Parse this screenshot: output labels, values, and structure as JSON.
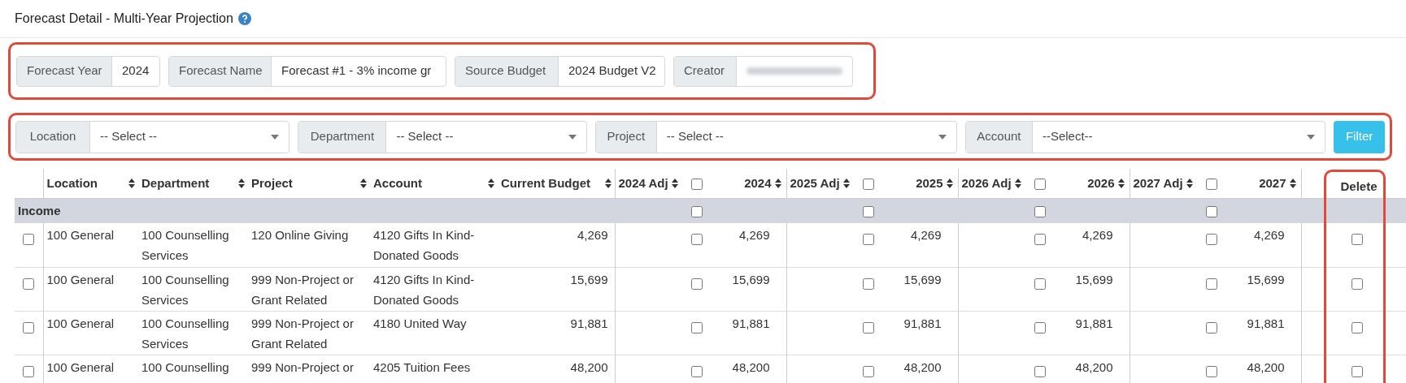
{
  "page_title": "Forecast Detail - Multi-Year Projection",
  "info_fields": [
    {
      "label": "Forecast Year",
      "value": "2024"
    },
    {
      "label": "Forecast Name",
      "value": "Forecast #1 - 3% income gr"
    },
    {
      "label": "Source Budget",
      "value": "2024 Budget V2"
    },
    {
      "label": "Creator",
      "kind": "blurred"
    }
  ],
  "filters": [
    {
      "label": "Location",
      "value": "-- Select --"
    },
    {
      "label": "Department",
      "value": "-- Select --"
    },
    {
      "label": "Project",
      "value": "-- Select --"
    },
    {
      "label": "Account",
      "value": "--Select--"
    }
  ],
  "filter_button": "Filter",
  "table": {
    "columns": [
      "Location",
      "Department",
      "Project",
      "Account",
      "Current Budget"
    ],
    "years": [
      {
        "adj_label": "2024 Adj",
        "checked": false,
        "label": "2024"
      },
      {
        "adj_label": "2025 Adj",
        "checked": false,
        "label": "2025"
      },
      {
        "adj_label": "2026 Adj",
        "checked": false,
        "label": "2026"
      },
      {
        "adj_label": "2027 Adj",
        "checked": false,
        "label": "2027"
      }
    ],
    "delete_label": "Delete",
    "group": {
      "label": "Income",
      "year_checks": [
        false,
        false,
        false,
        false
      ]
    },
    "rows": [
      {
        "checked": false,
        "cells": [
          "100 General",
          "100 Counselling Services",
          "120 Online Giving",
          "4120 Gifts In Kind-Donated Goods",
          "4,269"
        ],
        "years": [
          {
            "checked": false,
            "value": "4,269"
          },
          {
            "checked": false,
            "value": "4,269"
          },
          {
            "checked": false,
            "value": "4,269"
          },
          {
            "checked": false,
            "value": "4,269"
          }
        ],
        "delete": false
      },
      {
        "checked": false,
        "cells": [
          "100 General",
          "100 Counselling Services",
          "999 Non-Project or Grant Related",
          "4120 Gifts In Kind-Donated Goods",
          "15,699"
        ],
        "years": [
          {
            "checked": false,
            "value": "15,699"
          },
          {
            "checked": false,
            "value": "15,699"
          },
          {
            "checked": false,
            "value": "15,699"
          },
          {
            "checked": false,
            "value": "15,699"
          }
        ],
        "delete": false
      },
      {
        "checked": false,
        "cells": [
          "100 General",
          "100 Counselling Services",
          "999 Non-Project or Grant Related",
          "4180 United Way",
          "91,881"
        ],
        "years": [
          {
            "checked": false,
            "value": "91,881"
          },
          {
            "checked": false,
            "value": "91,881"
          },
          {
            "checked": false,
            "value": "91,881"
          },
          {
            "checked": false,
            "value": "91,881"
          }
        ],
        "delete": false
      },
      {
        "checked": false,
        "cells": [
          "100 General",
          "100 Counselling",
          "999 Non-Project or",
          "4205 Tuition Fees",
          "48,200"
        ],
        "years": [
          {
            "checked": false,
            "value": "48,200"
          },
          {
            "checked": false,
            "value": "48,200"
          },
          {
            "checked": false,
            "value": "48,200"
          },
          {
            "checked": false,
            "value": "48,200"
          }
        ],
        "delete": false
      }
    ]
  },
  "highlights": [
    {
      "kind": "outline"
    }
  ]
}
